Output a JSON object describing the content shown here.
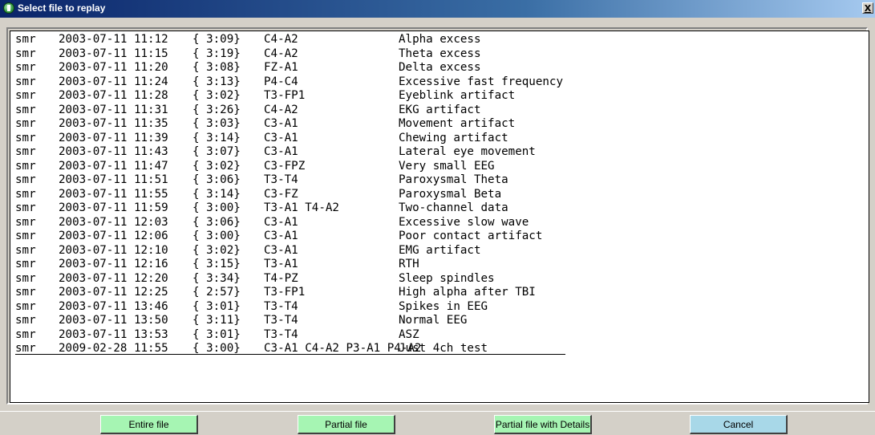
{
  "window": {
    "title": "Select file to replay",
    "close_label": "X"
  },
  "files": [
    {
      "type": "smr",
      "datetime": "2003-07-11 11:12",
      "duration": "{ 3:09}",
      "channels": "C4-A2",
      "description": "Alpha excess"
    },
    {
      "type": "smr",
      "datetime": "2003-07-11 11:15",
      "duration": "{ 3:19}",
      "channels": "C4-A2",
      "description": "Theta excess"
    },
    {
      "type": "smr",
      "datetime": "2003-07-11 11:20",
      "duration": "{ 3:08}",
      "channels": "FZ-A1",
      "description": "Delta excess"
    },
    {
      "type": "smr",
      "datetime": "2003-07-11 11:24",
      "duration": "{ 3:13}",
      "channels": "P4-C4",
      "description": "Excessive fast frequency"
    },
    {
      "type": "smr",
      "datetime": "2003-07-11 11:28",
      "duration": "{ 3:02}",
      "channels": "T3-FP1",
      "description": "Eyeblink artifact"
    },
    {
      "type": "smr",
      "datetime": "2003-07-11 11:31",
      "duration": "{ 3:26}",
      "channels": "C4-A2",
      "description": "EKG artifact"
    },
    {
      "type": "smr",
      "datetime": "2003-07-11 11:35",
      "duration": "{ 3:03}",
      "channels": "C3-A1",
      "description": "Movement artifact"
    },
    {
      "type": "smr",
      "datetime": "2003-07-11 11:39",
      "duration": "{ 3:14}",
      "channels": "C3-A1",
      "description": "Chewing artifact"
    },
    {
      "type": "smr",
      "datetime": "2003-07-11 11:43",
      "duration": "{ 3:07}",
      "channels": "C3-A1",
      "description": "Lateral eye movement"
    },
    {
      "type": "smr",
      "datetime": "2003-07-11 11:47",
      "duration": "{ 3:02}",
      "channels": "C3-FPZ",
      "description": "Very small EEG"
    },
    {
      "type": "smr",
      "datetime": "2003-07-11 11:51",
      "duration": "{ 3:06}",
      "channels": "T3-T4",
      "description": "Paroxysmal Theta"
    },
    {
      "type": "smr",
      "datetime": "2003-07-11 11:55",
      "duration": "{ 3:14}",
      "channels": "C3-FZ",
      "description": "Paroxysmal Beta"
    },
    {
      "type": "smr",
      "datetime": "2003-07-11 11:59",
      "duration": "{ 3:00}",
      "channels": "T3-A1 T4-A2",
      "description": "Two-channel data"
    },
    {
      "type": "smr",
      "datetime": "2003-07-11 12:03",
      "duration": "{ 3:06}",
      "channels": "C3-A1",
      "description": "Excessive slow wave"
    },
    {
      "type": "smr",
      "datetime": "2003-07-11 12:06",
      "duration": "{ 3:00}",
      "channels": "C3-A1",
      "description": "Poor contact artifact"
    },
    {
      "type": "smr",
      "datetime": "2003-07-11 12:10",
      "duration": "{ 3:02}",
      "channels": "C3-A1",
      "description": "EMG artifact"
    },
    {
      "type": "smr",
      "datetime": "2003-07-11 12:16",
      "duration": "{ 3:15}",
      "channels": "T3-A1",
      "description": "RTH"
    },
    {
      "type": "smr",
      "datetime": "2003-07-11 12:20",
      "duration": "{ 3:34}",
      "channels": "T4-PZ",
      "description": "Sleep spindles"
    },
    {
      "type": "smr",
      "datetime": "2003-07-11 12:25",
      "duration": "{ 2:57}",
      "channels": "T3-FP1",
      "description": "High alpha after TBI"
    },
    {
      "type": "smr",
      "datetime": "2003-07-11 13:46",
      "duration": "{ 3:01}",
      "channels": "T3-T4",
      "description": "Spikes in EEG"
    },
    {
      "type": "smr",
      "datetime": "2003-07-11 13:50",
      "duration": "{ 3:11}",
      "channels": "T3-T4",
      "description": "Normal EEG"
    },
    {
      "type": "smr",
      "datetime": "2003-07-11 13:53",
      "duration": "{ 3:01}",
      "channels": "T3-T4",
      "description": "ASZ"
    },
    {
      "type": "smr",
      "datetime": "2009-02-28 11:55",
      "duration": "{ 3:00}",
      "channels": "C3-A1 C4-A2 P3-A1 P4-A2",
      "description": "Just 4ch test",
      "selected": true
    }
  ],
  "buttons": {
    "entire": "Entire file",
    "partial": "Partial file",
    "details": "Partial file with Details",
    "cancel": "Cancel"
  },
  "colors": {
    "title_start": "#0a246a",
    "title_end": "#a6caf0",
    "button_green": "#a6f5b3",
    "button_blue": "#a8d8e8",
    "face": "#d4d0c8"
  }
}
